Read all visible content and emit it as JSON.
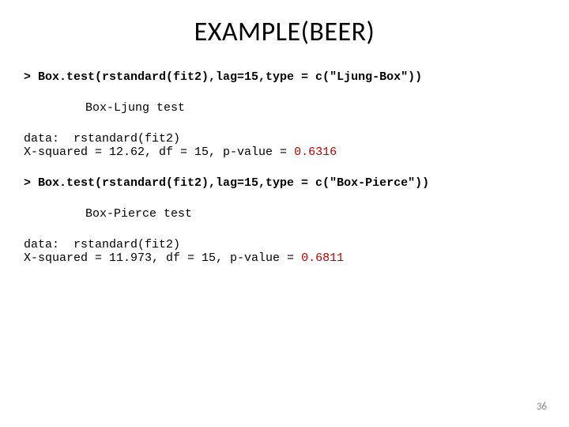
{
  "title": "EXAMPLE(BEER)",
  "block1": {
    "command": "> Box.test(rstandard(fit2),lag=15,type = c(\"Ljung-Box\"))",
    "test_name": "Box-Ljung test",
    "data_line": "data:  rstandard(fit2)",
    "result_prefix": "X-squared = 12.62, df = 15, p-value = ",
    "pvalue": "0.6316"
  },
  "block2": {
    "command": "> Box.test(rstandard(fit2),lag=15,type = c(\"Box-Pierce\"))",
    "test_name": "Box-Pierce test",
    "data_line": "data:  rstandard(fit2)",
    "result_prefix": "X-squared = 11.973, df = 15, p-value = ",
    "pvalue": "0.6811"
  },
  "page_number": "36"
}
